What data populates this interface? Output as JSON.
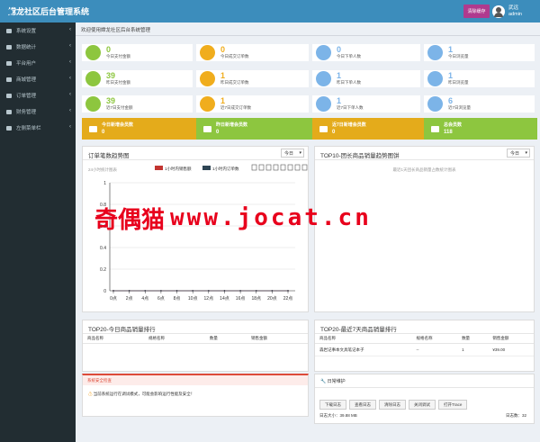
{
  "app": {
    "title": "嫦龙社区后台管理系统"
  },
  "topbar": {
    "clear_cache": "清除缓存",
    "user_name": "武远",
    "user_role": "admin"
  },
  "sidebar": {
    "items": [
      {
        "label": "系统设置",
        "chevron": "‹"
      },
      {
        "label": "数据统计",
        "chevron": "‹"
      },
      {
        "label": "平台用户",
        "chevron": "‹"
      },
      {
        "label": "商城管理",
        "chevron": "‹"
      },
      {
        "label": "订单管理",
        "chevron": "‹"
      },
      {
        "label": "财务管理",
        "chevron": "‹"
      },
      {
        "label": "左侧菜单栏",
        "chevron": "‹"
      }
    ]
  },
  "breadcrumb": "欢迎使用嫦龙社区后台系统管理",
  "stats": [
    {
      "value": "0",
      "label": "今日支付金额",
      "color": "#8dc63f"
    },
    {
      "value": "0",
      "label": "今日成交订单数",
      "color": "#f0ad1d"
    },
    {
      "value": "0",
      "label": "今日下单人数",
      "color": "#7cb4e8"
    },
    {
      "value": "1",
      "label": "今日浏览量",
      "color": "#7cb4e8"
    },
    {
      "value": "39",
      "label": "昨日支付金额",
      "color": "#8dc63f"
    },
    {
      "value": "1",
      "label": "昨日成交订单数",
      "color": "#f0ad1d"
    },
    {
      "value": "1",
      "label": "昨日下单人数",
      "color": "#7cb4e8"
    },
    {
      "value": "1",
      "label": "昨日浏览量",
      "color": "#7cb4e8"
    },
    {
      "value": "39",
      "label": "近7日支付金额",
      "color": "#8dc63f"
    },
    {
      "value": "1",
      "label": "近7日成交订单数",
      "color": "#f0ad1d"
    },
    {
      "value": "1",
      "label": "近7日下单人数",
      "color": "#7cb4e8"
    },
    {
      "value": "6",
      "label": "近7日浏览量",
      "color": "#7cb4e8"
    }
  ],
  "members": [
    {
      "label": "今日新增会员数",
      "value": "0",
      "color": "#e4ab1b"
    },
    {
      "label": "昨日新增会员数",
      "value": "0",
      "color": "#8dc63f"
    },
    {
      "label": "近7日新增会员数",
      "value": "0",
      "color": "#e4ab1b"
    },
    {
      "label": "总会员数",
      "value": "118",
      "color": "#8dc63f"
    }
  ],
  "order_chart": {
    "title": "订单笔数趋势图",
    "period": "今日",
    "subtitle": "24小时统计图表",
    "legend": [
      "1小时内销售额",
      "1小时内订单数"
    ],
    "legend_colors": [
      "#c23531",
      "#2f4554"
    ]
  },
  "chart_data": {
    "type": "line",
    "title": "",
    "x": [
      "0点",
      "2点",
      "4点",
      "6点",
      "8点",
      "10点",
      "12点",
      "14点",
      "16点",
      "18点",
      "20点",
      "22点"
    ],
    "yticks": [
      "0",
      "0.2",
      "0.4",
      "0.6",
      "0.8",
      "1"
    ],
    "ylim": [
      0,
      1
    ],
    "grid": true,
    "series": [
      {
        "name": "1小时内销售额",
        "values": [
          0,
          0,
          0,
          0,
          0,
          0,
          0,
          0,
          0,
          0,
          0,
          0
        ]
      },
      {
        "name": "1小时内订单数",
        "values": [
          0,
          0,
          0,
          0,
          0,
          0,
          0,
          0,
          0,
          0,
          0,
          0
        ]
      }
    ]
  },
  "top10": {
    "title": "TOP10-团长商品销量趋势图饼",
    "period": "今日",
    "subtitle": "最近1天团长商品销量占数统计图表"
  },
  "top20_today": {
    "title": "TOP20-今日商品销量排行",
    "cols": [
      "商品名称",
      "规格名称",
      "数量",
      "销售金额"
    ]
  },
  "top20_week": {
    "title": "TOP20-最近7天商品销量排行",
    "cols": [
      "商品名称",
      "规格名称",
      "数量",
      "销售金额"
    ],
    "rows": [
      {
        "name": "森岩记事本文具笔记本子",
        "spec": "--",
        "qty": "1",
        "amount": "¥39.00"
      }
    ]
  },
  "security": {
    "title": "系统安全检查",
    "message": "当前系统运行在调试模式，可能会影响运行性能及安全！",
    "accent": "#dd4b39"
  },
  "maintenance": {
    "title": "日常维护",
    "buttons": [
      "下载日志",
      "查看日志",
      "清除日志",
      "关闭调试",
      "打开Trace"
    ],
    "log_size": "日志大小：39.88 MB",
    "log_count": "日志数：32"
  },
  "watermark": {
    "cn": "奇偶猫",
    "url": "www.jocat.cn"
  }
}
